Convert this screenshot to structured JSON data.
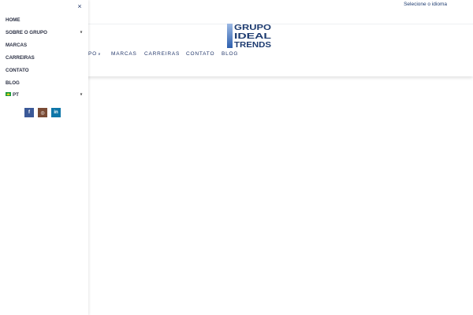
{
  "topbar": {
    "language_link": "Selecione o idioma"
  },
  "logo": {
    "lines": [
      "GRUPO",
      "IDEAL",
      "TRENDS"
    ]
  },
  "main_nav": {
    "items": [
      {
        "label": "PO"
      },
      {
        "label": "MARCAS"
      },
      {
        "label": "CARREIRAS"
      },
      {
        "label": "CONTATO"
      },
      {
        "label": "BLOG"
      }
    ]
  },
  "drawer": {
    "close_label": "×",
    "items": [
      {
        "label": "HOME"
      },
      {
        "label": "SOBRE O GRUPO"
      },
      {
        "label": "MARCAS"
      },
      {
        "label": "CARREIRAS"
      },
      {
        "label": "CONTATO"
      },
      {
        "label": "BLOG"
      },
      {
        "label": "PT"
      }
    ],
    "socials": [
      {
        "glyph": "f",
        "icon": "facebook-icon",
        "color": "#3b5998"
      },
      {
        "glyph": "◎",
        "icon": "instagram-icon",
        "color": "#7a4b35"
      },
      {
        "glyph": "in",
        "icon": "linkedin-icon",
        "color": "#0e76a8"
      }
    ]
  },
  "colors": {
    "nav_text": "#24386b",
    "logo_blue": "#1d3b70",
    "logo_light": "#3f73c0"
  }
}
